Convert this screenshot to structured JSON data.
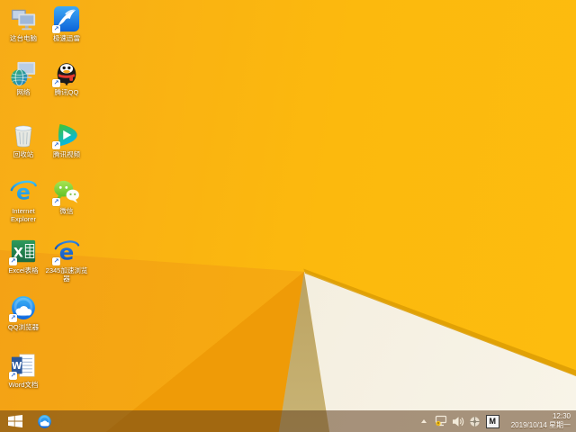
{
  "colors": {
    "wallpaper_orange": "#FBB30F",
    "wallpaper_bright": "#FDBC0E",
    "wallpaper_dark_facet": "#EF9B07",
    "wallpaper_olive": "#B89F5E",
    "wallpaper_cream": "#F3EDDD",
    "taskbar_tint": "rgba(92,58,24,0.52)",
    "label_text": "#FFFFFF"
  },
  "desktop_icons": [
    {
      "label": "这台电脑",
      "icon": "this-pc",
      "col": 1,
      "row": 1,
      "shortcut": false
    },
    {
      "label": "极速迅雷",
      "icon": "thunder",
      "col": 2,
      "row": 1,
      "shortcut": true
    },
    {
      "label": "网络",
      "icon": "network",
      "col": 1,
      "row": 2,
      "shortcut": false
    },
    {
      "label": "腾讯QQ",
      "icon": "qq",
      "col": 2,
      "row": 2,
      "shortcut": true
    },
    {
      "label": "回收站",
      "icon": "recycle-bin",
      "col": 1,
      "row": 3,
      "shortcut": false
    },
    {
      "label": "腾讯视频",
      "icon": "tencent-video",
      "col": 2,
      "row": 3,
      "shortcut": true
    },
    {
      "label": "Internet Explorer",
      "icon": "internet-explorer",
      "col": 1,
      "row": 4,
      "shortcut": false
    },
    {
      "label": "微信",
      "icon": "wechat",
      "col": 2,
      "row": 4,
      "shortcut": true
    },
    {
      "label": "Excel表格",
      "icon": "excel",
      "col": 1,
      "row": 5,
      "shortcut": true
    },
    {
      "label": "2345加速浏览器",
      "icon": "browser-2345",
      "col": 2,
      "row": 5,
      "shortcut": true
    },
    {
      "label": "QQ浏览器",
      "icon": "qq-browser",
      "col": 1,
      "row": 6,
      "shortcut": true
    },
    {
      "label": "Word文档",
      "icon": "word",
      "col": 1,
      "row": 7,
      "shortcut": true
    }
  ],
  "taskbar": {
    "pinned": [
      {
        "name": "qq-browser"
      }
    ],
    "tray": {
      "icon_names": [
        "hidden-icons-chevron",
        "network-warning",
        "volume",
        "sync-circle",
        "ime-indicator"
      ],
      "ime_indicator": "M",
      "time": "12:30",
      "date": "2019/10/14 星期一"
    }
  }
}
